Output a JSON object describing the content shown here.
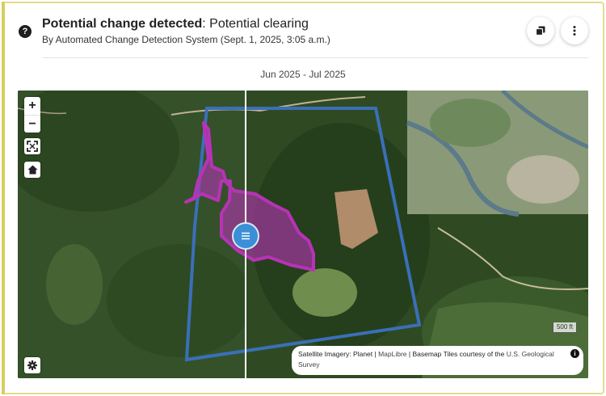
{
  "header": {
    "help_icon_glyph": "?",
    "title_bold": "Potential change detected",
    "title_rest": ": Potential clearing",
    "subtitle": "By Automated Change Detection System (Sept. 1, 2025, 3:05 a.m.)",
    "actions": [
      {
        "name": "copy",
        "icon": "copy-icon"
      },
      {
        "name": "more",
        "icon": "more-vertical-icon"
      }
    ]
  },
  "date_range": "Jun 2025 - Jul 2025",
  "map": {
    "controls": {
      "zoom_in": "+",
      "zoom_out": "−",
      "fullscreen_icon": "fullscreen-icon",
      "home_icon": "home-icon",
      "settings_icon": "gear-icon"
    },
    "compare_handle_icon": "menu-lines-icon",
    "scale_label": "500 ft",
    "attribution": {
      "imagery_label": "Satellite Imagery: ",
      "imagery_source": "Planet",
      "sep1": " | ",
      "maplibre": "MapLibre",
      "sep2": " | ",
      "basemap": "Basemap Tiles courtesy of the ",
      "usgs": "U.S. Geological Survey",
      "info_glyph": "i"
    },
    "colors": {
      "aoi_outline": "#3b6fb8",
      "change_polygon": "#b733b6",
      "compare_handle": "#3a8fd6"
    }
  }
}
